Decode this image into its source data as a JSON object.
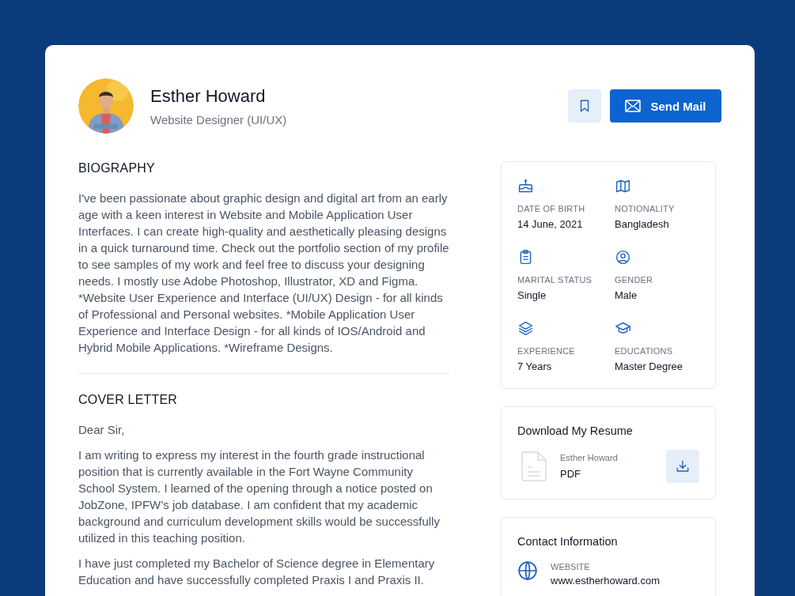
{
  "profile": {
    "name": "Esther Howard",
    "role": "Website Designer (UI/UX)"
  },
  "send_button": {
    "label": "Send Mail"
  },
  "biography": {
    "heading": "BIOGRAPHY",
    "text": "I've been passionate about graphic design and digital art from an early age with a keen interest in Website and Mobile Application User Interfaces. I can create high-quality and aesthetically pleasing designs in a quick turnaround time. Check out the portfolio section of my profile to see samples of my work and feel free to discuss your designing needs. I mostly use Adobe Photoshop, Illustrator, XD and Figma. *Website User Experience and Interface (UI/UX) Design - for all kinds of Professional and Personal websites. *Mobile Application User Experience and Interface Design - for all kinds of IOS/Android and Hybrid Mobile Applications. *Wireframe Designs."
  },
  "cover_letter": {
    "heading": "COVER LETTER",
    "paragraphs": [
      "Dear Sir,",
      "I am writing to express my interest in the fourth grade instructional position that is currently available in the Fort Wayne Community School System. I learned of the opening through a notice posted on JobZone, IPFW’s job database. I am confident that my academic background and curriculum development skills would be successfully utilized in this teaching position.",
      "I have just completed my Bachelor of Science degree in Elementary Education and have successfully completed Praxis I and Praxis II."
    ]
  },
  "details": [
    {
      "kind": "cake",
      "label": "DATE OF BIRTH",
      "value": "14 June, 2021"
    },
    {
      "kind": "map",
      "label": "NOTIONALITY",
      "value": "Bangladesh"
    },
    {
      "kind": "clipboard",
      "label": "MARITAL STATUS",
      "value": "Single"
    },
    {
      "kind": "user",
      "label": "GENDER",
      "value": "Male"
    },
    {
      "kind": "layers",
      "label": "EXPERIENCE",
      "value": "7 Years"
    },
    {
      "kind": "cap",
      "label": "EDUCATIONS",
      "value": "Master Degree"
    }
  ],
  "resume": {
    "title": "Download My Resume",
    "file_name": "Esther Howard",
    "file_type": "PDF"
  },
  "contact": {
    "title": "Contact Information",
    "items": [
      {
        "kind": "globe",
        "label": "WEBSITE",
        "value": "www.estherhoward.com"
      }
    ]
  }
}
